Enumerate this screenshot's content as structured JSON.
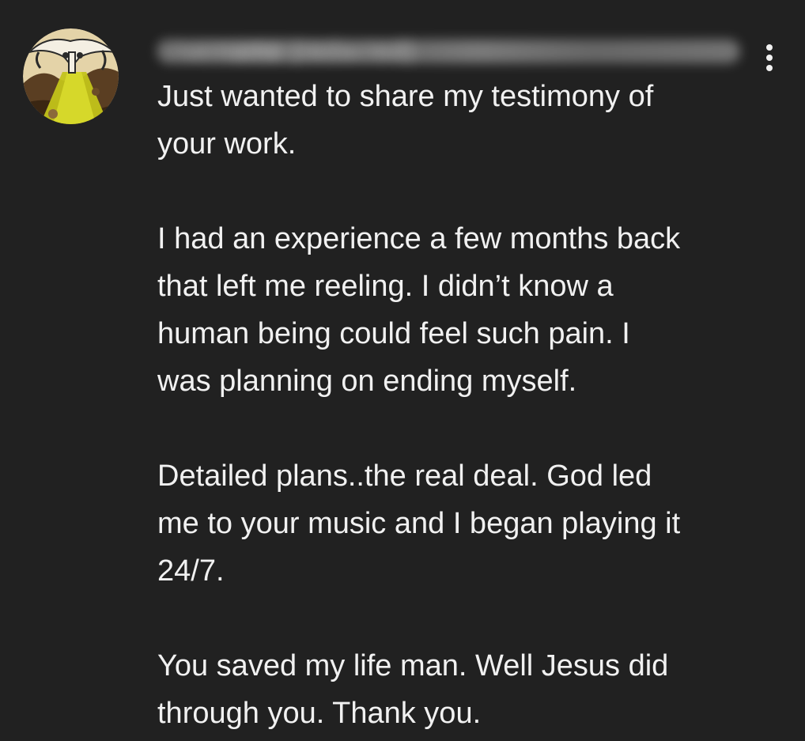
{
  "comment": {
    "author": "Username (redacted)",
    "menu_icon": "more-vert-icon",
    "avatar_icon": "avatar-image",
    "paragraphs": [
      {
        "lines": [
          "Just wanted to share my testimony of",
          "your work."
        ]
      },
      {
        "lines": [
          "I had an experience a few months back",
          "that left me reeling. I didn’t know a",
          "human being could feel such pain. I",
          "was planning on ending myself."
        ]
      },
      {
        "lines": [
          "Detailed plans..the real deal. God led",
          "me to your music and I began playing it",
          "24/7."
        ]
      },
      {
        "lines": [
          "You saved my life man. Well Jesus did",
          "through you. Thank you."
        ]
      }
    ]
  },
  "colors": {
    "background": "#212121",
    "text": "#f1f1f1"
  }
}
